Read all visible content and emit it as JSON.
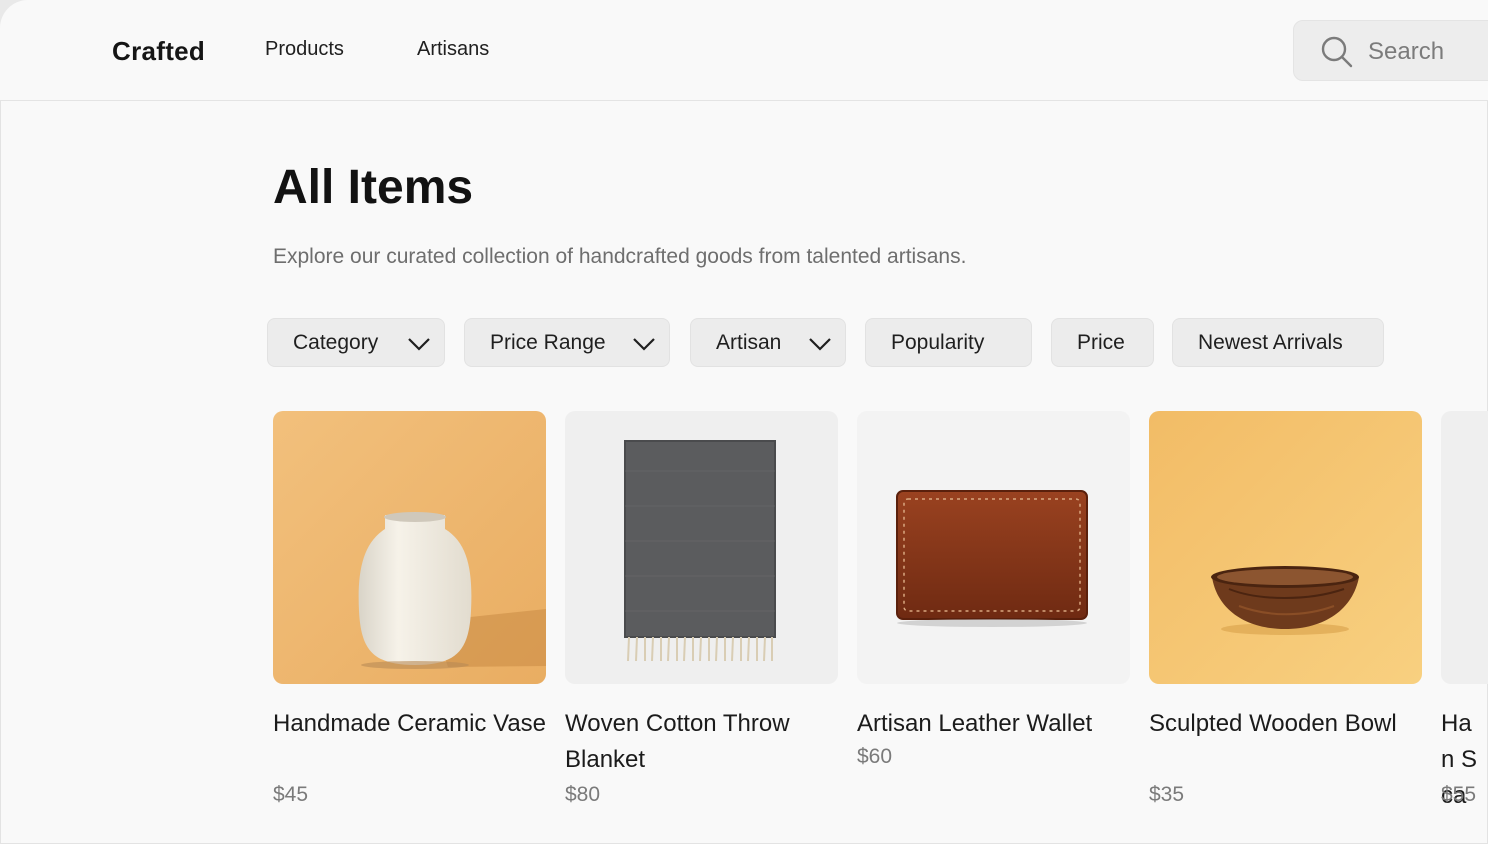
{
  "header": {
    "brand": "Crafted",
    "nav": [
      "Products",
      "Artisans"
    ],
    "search_placeholder": "Search"
  },
  "page": {
    "title": "All Items",
    "subtitle": "Explore our curated collection of handcrafted goods from talented artisans."
  },
  "filters": [
    {
      "label": "Category",
      "dropdown": true
    },
    {
      "label": "Price Range",
      "dropdown": true
    },
    {
      "label": "Artisan",
      "dropdown": true
    },
    {
      "label": "Popularity",
      "dropdown": false
    },
    {
      "label": "Price",
      "dropdown": false
    },
    {
      "label": "Newest Arrivals",
      "dropdown": false
    }
  ],
  "products": [
    {
      "name": "Handmade Ceramic Vase",
      "price": "$45",
      "image": "vase-image"
    },
    {
      "name": "Woven Cotton Throw Blanket",
      "price": "$80",
      "image": "blanket-image"
    },
    {
      "name": "Artisan Leather Wallet",
      "price": "$60",
      "image": "wallet-image"
    },
    {
      "name": "Sculpted Wooden Bowl",
      "price": "$35",
      "image": "bowl-image"
    },
    {
      "name": "Han Sca",
      "price": "$55",
      "image": "scarf-image"
    }
  ],
  "colors": {
    "background": "#f9f9f9",
    "chip": "#ececec",
    "vase_backdrop": "#f0bc78",
    "bowl_backdrop": "#f5c46a",
    "leather": "#8a3a1a"
  }
}
